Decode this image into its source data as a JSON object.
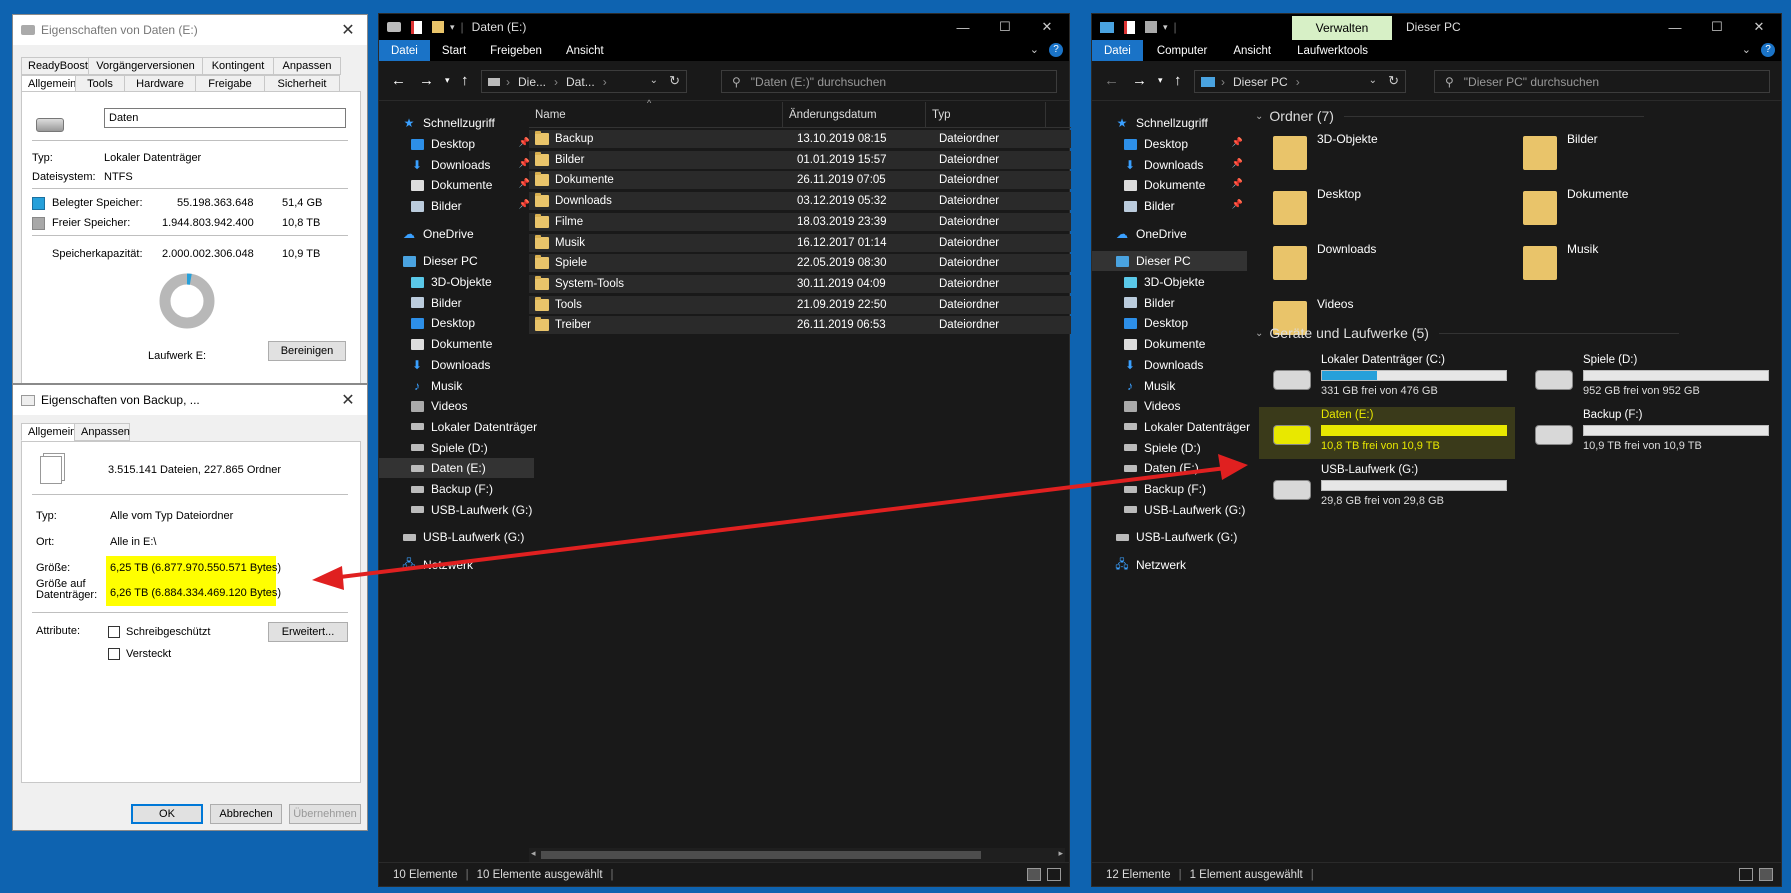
{
  "colors": {
    "desktop": "#0e63b0",
    "accent": "#1a73c7",
    "highlight": "#e8e800",
    "arrow": "#e02020"
  },
  "dlg1": {
    "title": "Eigenschaften von Daten (E:)",
    "tabs_row1": [
      "ReadyBoost",
      "Vorgängerversionen",
      "Kontingent",
      "Anpassen"
    ],
    "tabs_row2": [
      "Allgemein",
      "Tools",
      "Hardware",
      "Freigabe",
      "Sicherheit"
    ],
    "name_value": "Daten",
    "typ_label": "Typ:",
    "typ_value": "Lokaler Datenträger",
    "fs_label": "Dateisystem:",
    "fs_value": "NTFS",
    "used_label": "Belegter Speicher:",
    "used_bytes": "55.198.363.648",
    "used_size": "51,4 GB",
    "free_label": "Freier Speicher:",
    "free_bytes": "1.944.803.942.400",
    "free_size": "10,8 TB",
    "cap_label": "Speicherkapazität:",
    "cap_bytes": "2.000.002.306.048",
    "cap_size": "10,9 TB",
    "drive_label": "Laufwerk E:",
    "cleanup_button": "Bereinigen",
    "used_fraction": 0.0276
  },
  "dlg2": {
    "title": "Eigenschaften von Backup, ...",
    "tabs": [
      "Allgemein",
      "Anpassen"
    ],
    "summary": "3.515.141 Dateien, 227.865 Ordner",
    "typ_label": "Typ:",
    "typ_value": "Alle vom Typ Dateiordner",
    "ort_label": "Ort:",
    "ort_value": "Alle in E:\\",
    "size_label": "Größe:",
    "size_value": "6,25 TB (6.877.970.550.571 Bytes)",
    "disk_label_1": "Größe auf",
    "disk_label_2": "Datenträger:",
    "disk_value": "6,26 TB (6.884.334.469.120 Bytes)",
    "attr_label": "Attribute:",
    "readonly_label": "Schreibgeschützt",
    "hidden_label": "Versteckt",
    "advanced_button": "Erweitert...",
    "ok_button": "OK",
    "cancel_button": "Abbrechen",
    "apply_button": "Übernehmen"
  },
  "exp1": {
    "title": "Daten (E:)",
    "ribbon": [
      "Datei",
      "Start",
      "Freigeben",
      "Ansicht"
    ],
    "path_1": "Die...",
    "path_2": "Dat...",
    "search_placeholder": "\"Daten (E:)\" durchsuchen",
    "columns": [
      "Name",
      "Änderungsdatum",
      "Typ"
    ],
    "files": [
      {
        "name": "Backup",
        "date": "13.10.2019 08:15",
        "type": "Dateiordner"
      },
      {
        "name": "Bilder",
        "date": "01.01.2019 15:57",
        "type": "Dateiordner"
      },
      {
        "name": "Dokumente",
        "date": "26.11.2019 07:05",
        "type": "Dateiordner"
      },
      {
        "name": "Downloads",
        "date": "03.12.2019 05:32",
        "type": "Dateiordner"
      },
      {
        "name": "Filme",
        "date": "18.03.2019 23:39",
        "type": "Dateiordner"
      },
      {
        "name": "Musik",
        "date": "16.12.2017 01:14",
        "type": "Dateiordner"
      },
      {
        "name": "Spiele",
        "date": "22.05.2019 08:30",
        "type": "Dateiordner"
      },
      {
        "name": "System-Tools",
        "date": "30.11.2019 04:09",
        "type": "Dateiordner"
      },
      {
        "name": "Tools",
        "date": "21.09.2019 22:50",
        "type": "Dateiordner"
      },
      {
        "name": "Treiber",
        "date": "26.11.2019 06:53",
        "type": "Dateiordner"
      }
    ],
    "status_count": "10 Elemente",
    "status_sel": "10 Elemente ausgewählt"
  },
  "nav": {
    "quick": "Schnellzugriff",
    "quick_items": [
      "Desktop",
      "Downloads",
      "Dokumente",
      "Bilder"
    ],
    "onedrive": "OneDrive",
    "pc": "Dieser PC",
    "pc_items": [
      "3D-Objekte",
      "Bilder",
      "Desktop",
      "Dokumente",
      "Downloads",
      "Musik",
      "Videos",
      "Lokaler Datenträger",
      "Spiele (D:)",
      "Daten (E:)",
      "Backup (F:)",
      "USB-Laufwerk (G:)"
    ],
    "usb": "USB-Laufwerk (G:)",
    "network": "Netzwerk"
  },
  "exp2": {
    "title": "Dieser PC",
    "manage_tab": "Verwalten",
    "ribbon": [
      "Datei",
      "Computer",
      "Ansicht",
      "Laufwerktools"
    ],
    "path": "Dieser PC",
    "search_placeholder": "\"Dieser PC\" durchsuchen",
    "folders_header": "Ordner (7)",
    "folders": [
      "3D-Objekte",
      "Bilder",
      "Desktop",
      "Dokumente",
      "Downloads",
      "Musik",
      "Videos"
    ],
    "drives_header": "Geräte und Laufwerke (5)",
    "drives": [
      {
        "name": "Lokaler Datenträger (C:)",
        "free": "331 GB frei von 476 GB",
        "used_fraction": 0.3
      },
      {
        "name": "Spiele (D:)",
        "free": "952 GB frei von 952 GB",
        "used_fraction": 0.0
      },
      {
        "name": "Daten (E:)",
        "free": "10,8 TB frei von 10,9 TB",
        "used_fraction": 0.01
      },
      {
        "name": "Backup (F:)",
        "free": "10,9 TB frei von 10,9 TB",
        "used_fraction": 0.0
      },
      {
        "name": "USB-Laufwerk (G:)",
        "free": "29,8 GB frei von 29,8 GB",
        "used_fraction": 0.0
      }
    ],
    "status_count": "12 Elemente",
    "status_sel": "1 Element ausgewählt"
  }
}
